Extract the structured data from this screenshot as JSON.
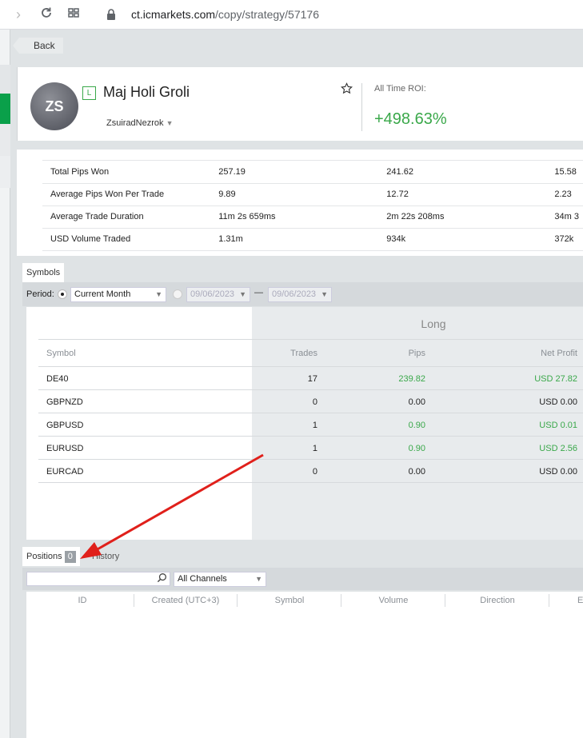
{
  "browser": {
    "url_domain": "ct.icmarkets.com",
    "url_path": "/copy/strategy/57176"
  },
  "back_label": "Back",
  "strategy": {
    "type_badge": "L",
    "name": "Maj Holi Groli",
    "avatar_initials": "ZS",
    "owner": "ZsuiradNezrok",
    "roi_label": "All Time ROI:",
    "roi_value": "+498.63%"
  },
  "stats_rows": [
    {
      "label": "Total Pips Won",
      "c1": "257.19",
      "c2": "241.62",
      "c3": "15.58"
    },
    {
      "label": "Average Pips Won Per Trade",
      "c1": "9.89",
      "c2": "12.72",
      "c3": "2.23"
    },
    {
      "label": "Average Trade Duration",
      "c1": "11m 2s 659ms",
      "c2": "2m 22s 208ms",
      "c3": "34m 3"
    },
    {
      "label": "USD Volume Traded",
      "c1": "1.31m",
      "c2": "934k",
      "c3": "372k"
    }
  ],
  "symbols_tab": "Symbols",
  "period": {
    "label": "Period:",
    "selected": "Current Month",
    "date_from": "09/06/2023",
    "dash": "—",
    "date_to": "09/06/2023"
  },
  "symbols_table": {
    "group_header": "Long",
    "columns": {
      "symbol": "Symbol",
      "trades": "Trades",
      "pips": "Pips",
      "net_profit": "Net Profit"
    },
    "rows": [
      {
        "symbol": "DE40",
        "trades": "17",
        "pips": "239.82",
        "net_profit": "USD 27.82",
        "positive": true
      },
      {
        "symbol": "GBPNZD",
        "trades": "0",
        "pips": "0.00",
        "net_profit": "USD 0.00",
        "positive": false
      },
      {
        "symbol": "GBPUSD",
        "trades": "1",
        "pips": "0.90",
        "net_profit": "USD 0.01",
        "positive": true
      },
      {
        "symbol": "EURUSD",
        "trades": "1",
        "pips": "0.90",
        "net_profit": "USD 2.56",
        "positive": true
      },
      {
        "symbol": "EURCAD",
        "trades": "0",
        "pips": "0.00",
        "net_profit": "USD 0.00",
        "positive": false
      }
    ]
  },
  "positions": {
    "tab_label": "Positions",
    "count": "0",
    "history_tab": "History",
    "channel_selected": "All Channels",
    "columns": [
      "ID",
      "Created (UTC+3)",
      "Symbol",
      "Volume",
      "Direction",
      "E"
    ]
  },
  "colors": {
    "green": "#3aa84a",
    "arrow": "#e0201b"
  }
}
